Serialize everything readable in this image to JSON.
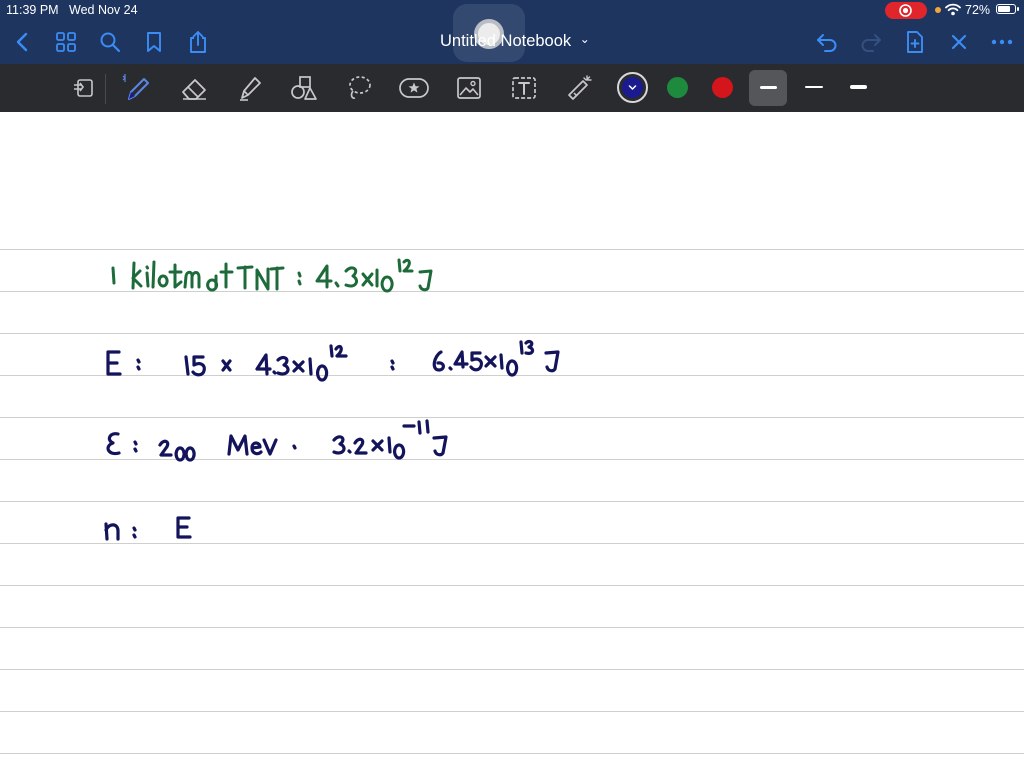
{
  "status_bar": {
    "time": "11:39 PM",
    "date": "Wed Nov 24",
    "battery_percent": "72%",
    "battery_level": 0.72
  },
  "nav": {
    "title": "Untitled Notebook",
    "title_chevron": "⌄"
  },
  "toolbar": {
    "tools": [
      "page-view-icon",
      "pen-icon",
      "eraser-icon",
      "highlighter-icon",
      "shapes-icon",
      "lasso-icon",
      "sticker-icon",
      "image-icon",
      "text-box-icon",
      "laser-pointer-icon"
    ],
    "active_tool": "pen-icon",
    "colors": [
      "#1b1b8f",
      "#1d8a3e",
      "#d4151b"
    ],
    "selected_color": "#1b1b8f",
    "stroke_widths": [
      "thin",
      "medium",
      "thick"
    ],
    "selected_stroke": "thin"
  },
  "notebook": {
    "lines": [
      "1 kiloton of TNT = 4.3×10^12 J",
      "E = 15 × 4.3×10^12 = 6.45×10^13 J",
      "ε = 200 MeV = 3.2×10^-11 J",
      "n = E"
    ],
    "ink_colors": {
      "green": "#1d6b3a",
      "navy": "#14145c"
    }
  }
}
